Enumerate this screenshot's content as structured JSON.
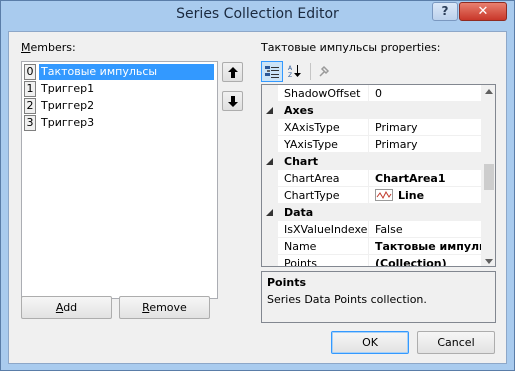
{
  "window": {
    "title": "Series Collection Editor",
    "help_label": "?",
    "close_label": "✕"
  },
  "members": {
    "label": "Members:",
    "items": [
      {
        "index": "0",
        "name": "Тактовые импульсы",
        "selected": true
      },
      {
        "index": "1",
        "name": "Триггер1",
        "selected": false
      },
      {
        "index": "2",
        "name": "Триггер2",
        "selected": false
      },
      {
        "index": "3",
        "name": "Триггер3",
        "selected": false
      }
    ],
    "add_label": "Add",
    "remove_label": "Remove"
  },
  "properties": {
    "label": "Тактовые импульсы properties:",
    "toolbar_icons": [
      "categorized-icon",
      "alphabetical-icon",
      "property-pages-icon"
    ],
    "rows": [
      {
        "kind": "prop",
        "name": "ShadowOffset",
        "value": "0"
      },
      {
        "kind": "cat",
        "name": "Axes"
      },
      {
        "kind": "prop",
        "name": "XAxisType",
        "value": "Primary"
      },
      {
        "kind": "prop",
        "name": "YAxisType",
        "value": "Primary"
      },
      {
        "kind": "cat",
        "name": "Chart"
      },
      {
        "kind": "prop",
        "name": "ChartArea",
        "value": "ChartArea1",
        "bold": true
      },
      {
        "kind": "prop",
        "name": "ChartType",
        "value": "Line",
        "bold": true,
        "icon": "line-chart-icon"
      },
      {
        "kind": "cat",
        "name": "Data"
      },
      {
        "kind": "prop",
        "name": "IsXValueIndexed",
        "value": "False"
      },
      {
        "kind": "prop",
        "name": "Name",
        "value": "Тактовые импульсы",
        "bold": true
      },
      {
        "kind": "prop",
        "name": "Points",
        "value": "(Collection)",
        "bold": true
      }
    ],
    "description": {
      "title": "Points",
      "text": "Series Data Points collection."
    }
  },
  "buttons": {
    "ok_label": "OK",
    "cancel_label": "Cancel"
  },
  "colors": {
    "selection": "#3399ff",
    "frame": "#a9cbee",
    "close": "#c8372a"
  }
}
